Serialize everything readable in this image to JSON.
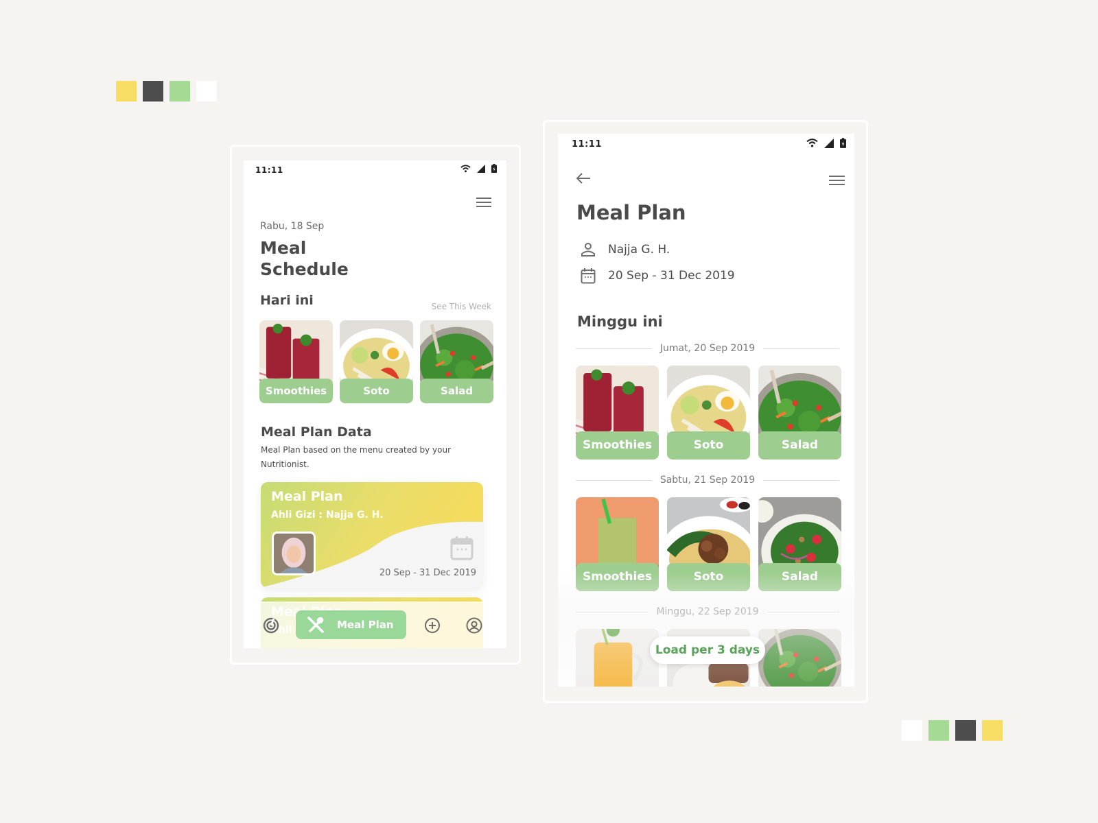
{
  "palette_top": [
    "#f7dd63",
    "#4d4d4d",
    "#a4da94",
    "#ffffff"
  ],
  "palette_bottom": [
    "#ffffff",
    "#a4da94",
    "#4d4d4d",
    "#f7dd63"
  ],
  "colors": {
    "accent_green": "#9dcd8f",
    "nav_green": "#9ad89a",
    "card_yellow": "#f5dd5e",
    "card_lime": "#c7dd72",
    "text_dark": "#4a4a4a"
  },
  "screen1": {
    "status_time": "11:11",
    "date": "Rabu, 18 Sep",
    "title": "Meal Schedule",
    "today_label": "Hari ini",
    "see_week_link": "See This Week",
    "today_foods": [
      {
        "label": "Smoothies",
        "image": "red-smoothie"
      },
      {
        "label": "Soto",
        "image": "soto-bowl"
      },
      {
        "label": "Salad",
        "image": "green-salad"
      }
    ],
    "meal_plan_data_title": "Meal Plan Data",
    "meal_plan_data_desc": "Meal Plan based on the menu created by your Nutritionist.",
    "plan_card": {
      "title": "Meal Plan",
      "subtitle": "Ahli Gizi : Najja G. H.",
      "date_range": "20 Sep - 31 Dec 2019",
      "icon": "calendar-icon"
    },
    "plan_card_2": {
      "title": "Meal Plan",
      "subtitle": "Ahli Gizi"
    },
    "bottom_nav": {
      "items": [
        {
          "icon": "radar-icon",
          "label": ""
        },
        {
          "icon": "fork-spoon-icon",
          "label": "Meal Plan",
          "active": true
        },
        {
          "icon": "plus-circle-icon",
          "label": ""
        },
        {
          "icon": "profile-icon",
          "label": ""
        }
      ]
    }
  },
  "screen2": {
    "status_time": "11:11",
    "title": "Meal Plan",
    "nutritionist": "Najja G. H.",
    "date_range": "20 Sep - 31 Dec 2019",
    "week_label": "Minggu ini",
    "days": [
      {
        "date": "Jumat, 20 Sep 2019",
        "foods": [
          {
            "label": "Smoothies",
            "image": "red-smoothie"
          },
          {
            "label": "Soto",
            "image": "soto-bowl"
          },
          {
            "label": "Salad",
            "image": "green-salad"
          }
        ]
      },
      {
        "date": "Sabtu, 21 Sep 2019",
        "foods": [
          {
            "label": "Smoothies",
            "image": "green-smoothie"
          },
          {
            "label": "Soto",
            "image": "noodle-bowl"
          },
          {
            "label": "Salad",
            "image": "spinach-salad"
          }
        ]
      },
      {
        "date": "Minggu, 22 Sep 2019",
        "foods": [
          {
            "label": "",
            "image": "mango-smoothie"
          },
          {
            "label": "",
            "image": "rice-plate"
          },
          {
            "label": "",
            "image": "green-salad"
          }
        ]
      }
    ],
    "load_button": "Load per 3 days"
  }
}
